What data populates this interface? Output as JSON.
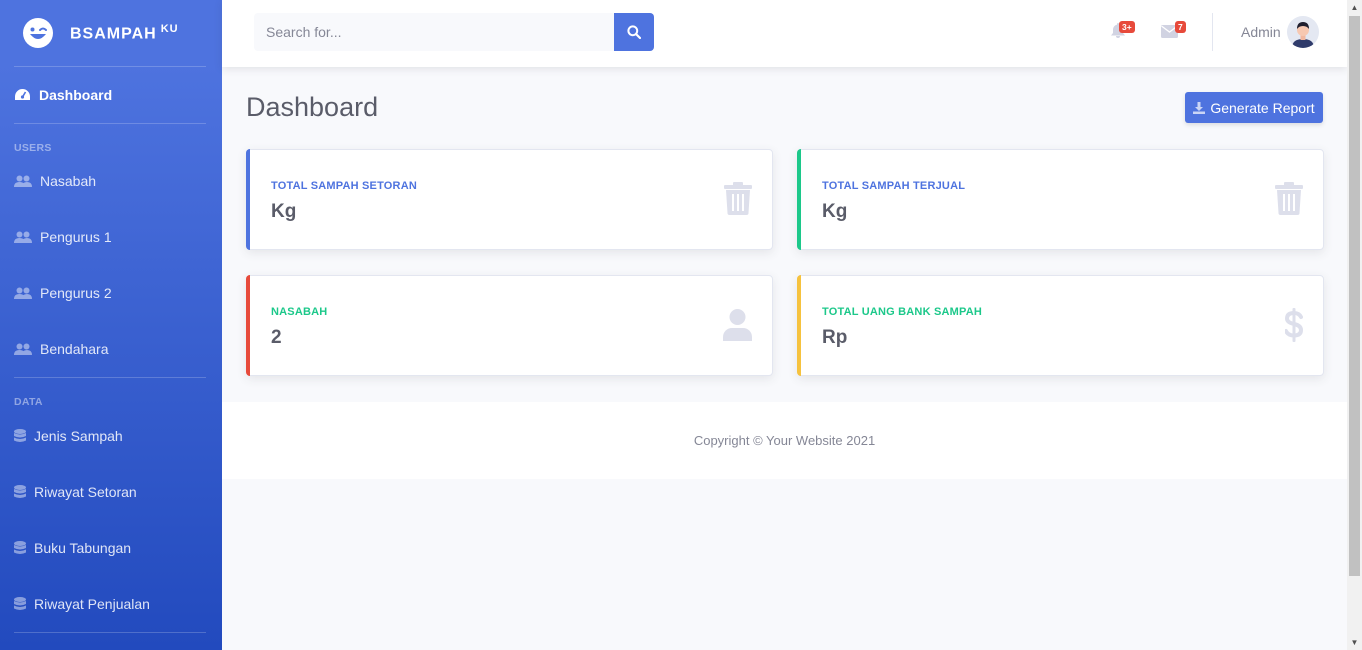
{
  "sidebar": {
    "brand": {
      "name": "BSAMPAH",
      "sup": "KU"
    },
    "active_item": {
      "label": "Dashboard",
      "icon": "tachometer-icon"
    },
    "sections": [
      {
        "heading": "USERS",
        "items": [
          {
            "label": "Nasabah",
            "icon": "users-icon"
          },
          {
            "label": "Pengurus 1",
            "icon": "users-icon"
          },
          {
            "label": "Pengurus 2",
            "icon": "users-icon"
          },
          {
            "label": "Bendahara",
            "icon": "users-icon"
          }
        ]
      },
      {
        "heading": "DATA",
        "items": [
          {
            "label": "Jenis Sampah",
            "icon": "database-icon"
          },
          {
            "label": "Riwayat Setoran",
            "icon": "database-icon"
          },
          {
            "label": "Buku Tabungan",
            "icon": "database-icon"
          },
          {
            "label": "Riwayat Penjualan",
            "icon": "database-icon"
          }
        ]
      }
    ]
  },
  "topbar": {
    "search": {
      "placeholder": "Search for...",
      "value": ""
    },
    "alerts_badge": "3+",
    "messages_badge": "7",
    "user_name": "Admin"
  },
  "main": {
    "title": "Dashboard",
    "report_button": "Generate Report",
    "cards": [
      {
        "label": "TOTAL SAMPAH SETORAN",
        "value": "Kg",
        "accent": "#4e73df",
        "label_color": "#4e73df",
        "icon": "trash-icon"
      },
      {
        "label": "TOTAL SAMPAH TERJUAL",
        "value": "Kg",
        "accent": "#1cc88a",
        "label_color": "#4e73df",
        "icon": "trash-icon"
      },
      {
        "label": "NASABAH",
        "value": "2",
        "accent": "#e74a3b",
        "label_color": "#1cc88a",
        "icon": "user-icon"
      },
      {
        "label": "TOTAL UANG BANK SAMPAH",
        "value": "Rp",
        "accent": "#f6c23e",
        "label_color": "#1cc88a",
        "icon": "dollar-icon"
      }
    ]
  },
  "footer": {
    "copyright": "Copyright © Your Website 2021"
  },
  "colors": {
    "primary": "#4e73df",
    "success": "#1cc88a",
    "danger": "#e74a3b",
    "warning": "#f6c23e",
    "icon_muted": "#dddfeb"
  }
}
